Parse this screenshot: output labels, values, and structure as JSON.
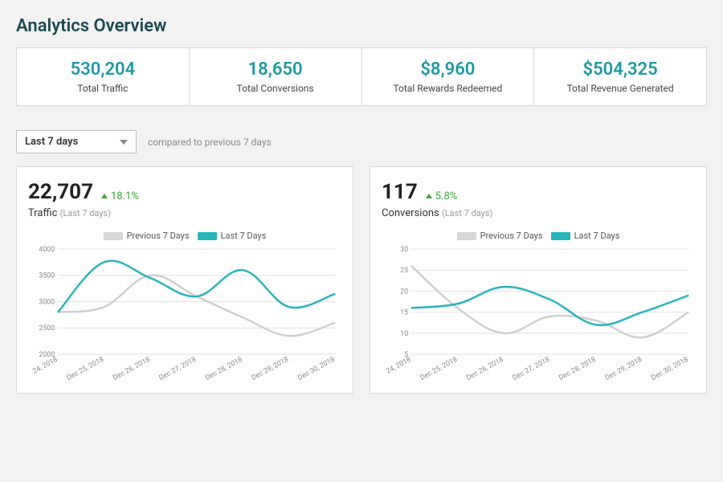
{
  "title": "Analytics Overview",
  "stats": [
    {
      "value": "530,204",
      "label": "Total Traffic"
    },
    {
      "value": "18,650",
      "label": "Total Conversions"
    },
    {
      "value": "$8,960",
      "label": "Total Rewards Redeemed"
    },
    {
      "value": "$504,325",
      "label": "Total Revenue Generated"
    }
  ],
  "range": {
    "selected": "Last 7 days",
    "compared": "compared to previous 7 days"
  },
  "legend": {
    "prev": "Previous 7 Days",
    "last": "Last 7 Days"
  },
  "charts": [
    {
      "value": "22,707",
      "delta": "18.1%",
      "label": "Traffic",
      "paren": "(Last 7 days)"
    },
    {
      "value": "117",
      "delta": "5.8%",
      "label": "Conversions",
      "paren": "(Last 7 days)"
    }
  ],
  "chart_data": [
    {
      "type": "line",
      "title": "Traffic",
      "ylabel": "",
      "xlabel": "",
      "ylim": [
        2000,
        4000
      ],
      "yticks": [
        2000,
        2500,
        3000,
        3500,
        4000
      ],
      "categories": [
        "24, 2018",
        "Dec 25, 2018",
        "Dec 26, 2018",
        "Dec 27, 2018",
        "Dec 28, 2018",
        "Dec 29, 2018",
        "Dec 30, 2018"
      ],
      "series": [
        {
          "name": "Previous 7 Days",
          "values": [
            2800,
            2900,
            3500,
            3100,
            2700,
            2350,
            2600
          ]
        },
        {
          "name": "Last 7 Days",
          "values": [
            2800,
            3750,
            3450,
            3100,
            3600,
            2900,
            3150
          ]
        }
      ]
    },
    {
      "type": "line",
      "title": "Conversions",
      "ylabel": "",
      "xlabel": "",
      "ylim": [
        5,
        30
      ],
      "yticks": [
        5,
        10,
        15,
        20,
        25,
        30
      ],
      "categories": [
        "24, 2018",
        "Dec 25, 2018",
        "Dec 26, 2018",
        "Dec 27, 2018",
        "Dec 28, 2018",
        "Dec 29, 2018",
        "Dec 30, 2018"
      ],
      "series": [
        {
          "name": "Previous 7 Days",
          "values": [
            26,
            16,
            10,
            14,
            13,
            9,
            15
          ]
        },
        {
          "name": "Last 7 Days",
          "values": [
            16,
            17,
            21,
            18,
            12,
            15,
            19
          ]
        }
      ]
    }
  ]
}
